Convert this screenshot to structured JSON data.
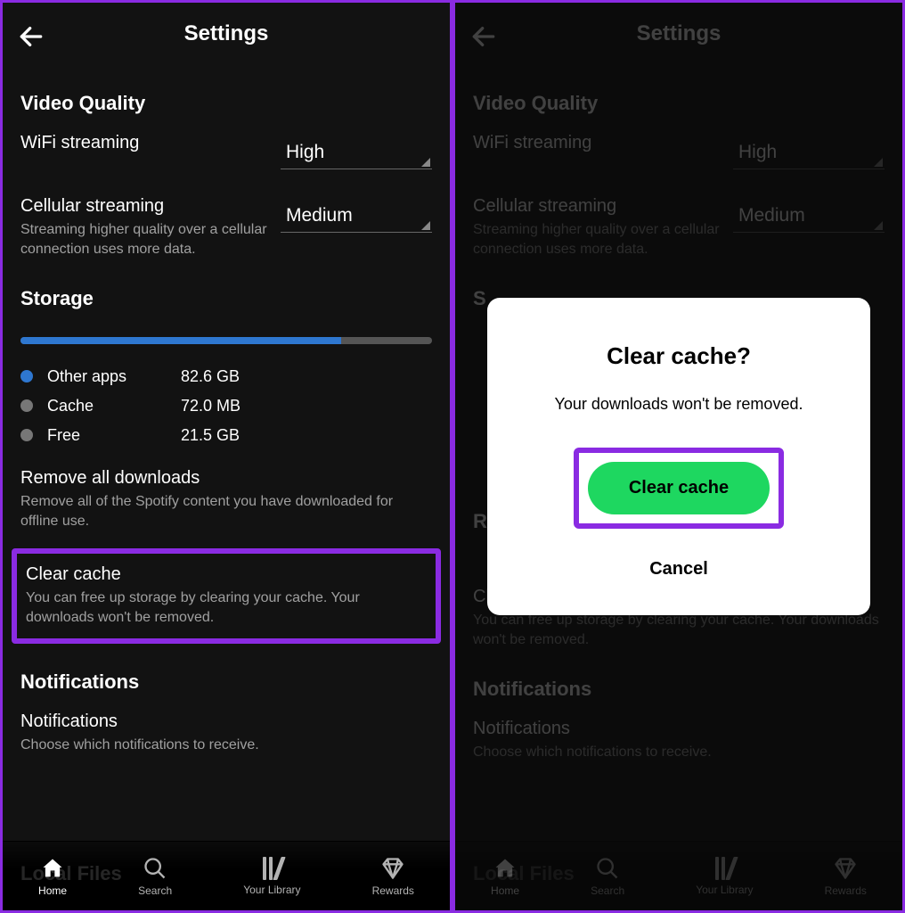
{
  "left": {
    "title": "Settings",
    "video_quality_heading": "Video Quality",
    "wifi": {
      "label": "WiFi streaming",
      "value": "High"
    },
    "cellular": {
      "label": "Cellular streaming",
      "desc": "Streaming higher quality over a cellular connection uses more data.",
      "value": "Medium"
    },
    "storage_heading": "Storage",
    "storage": {
      "other_label": "Other apps",
      "other_val": "82.6 GB",
      "cache_label": "Cache",
      "cache_val": "72.0 MB",
      "free_label": "Free",
      "free_val": "21.5 GB"
    },
    "remove": {
      "title": "Remove all downloads",
      "desc": "Remove all of the Spotify content you have downloaded for offline use."
    },
    "clear": {
      "title": "Clear cache",
      "desc": "You can free up storage by clearing your cache. Your downloads won't be removed."
    },
    "notif_heading": "Notifications",
    "notif_block": {
      "title": "Notifications",
      "desc": "Choose which notifications to receive."
    },
    "local_files_peek": "Local Files"
  },
  "right": {
    "title": "Settings",
    "video_quality_heading": "Video Quality",
    "wifi": {
      "label": "WiFi streaming",
      "value": "High"
    },
    "cellular": {
      "label": "Cellular streaming",
      "desc": "Streaming higher quality over a cellular connection uses more data.",
      "value": "Medium"
    },
    "storage_heading_peek": "S",
    "remove_peek": "R",
    "clear": {
      "title": "Clear cache",
      "desc": "You can free up storage by clearing your cache. Your downloads won't be removed."
    },
    "notif_heading": "Notifications",
    "notif_block": {
      "title": "Notifications",
      "desc": "Choose which notifications to receive."
    },
    "dialog": {
      "title": "Clear cache?",
      "body": "Your downloads won't be removed.",
      "confirm": "Clear cache",
      "cancel": "Cancel"
    },
    "local_files_peek": "Local Files"
  },
  "nav": {
    "home": "Home",
    "search": "Search",
    "library": "Your Library",
    "rewards": "Rewards"
  }
}
